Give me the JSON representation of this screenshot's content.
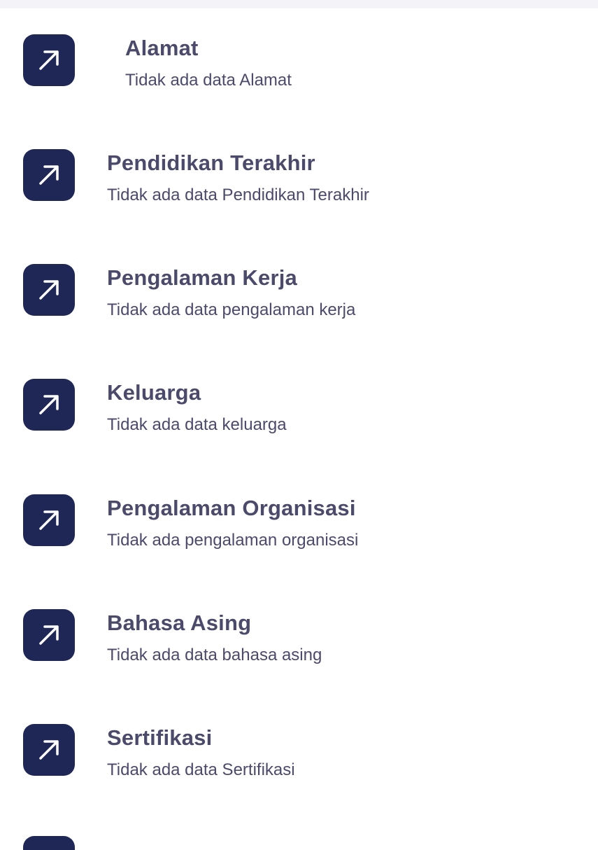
{
  "sections": [
    {
      "title": "Alamat",
      "subtitle": "Tidak ada data Alamat",
      "icon": "arrow-up-right-icon"
    },
    {
      "title": "Pendidikan Terakhir",
      "subtitle": "Tidak ada data Pendidikan Terakhir",
      "icon": "arrow-up-right-icon"
    },
    {
      "title": "Pengalaman Kerja",
      "subtitle": "Tidak ada data pengalaman kerja",
      "icon": "arrow-up-right-icon"
    },
    {
      "title": "Keluarga",
      "subtitle": "Tidak ada data keluarga",
      "icon": "arrow-up-right-icon"
    },
    {
      "title": "Pengalaman Organisasi",
      "subtitle": "Tidak ada pengalaman organisasi",
      "icon": "arrow-up-right-icon"
    },
    {
      "title": "Bahasa Asing",
      "subtitle": "Tidak ada data bahasa asing",
      "icon": "arrow-up-right-icon"
    },
    {
      "title": "Sertifikasi",
      "subtitle": "Tidak ada data Sertifikasi",
      "icon": "arrow-up-right-icon"
    }
  ],
  "colors": {
    "icon_background": "#1f2757",
    "icon_foreground": "#ffffff",
    "text": "#4c4a6b",
    "top_strip": "#f3f3f8"
  }
}
